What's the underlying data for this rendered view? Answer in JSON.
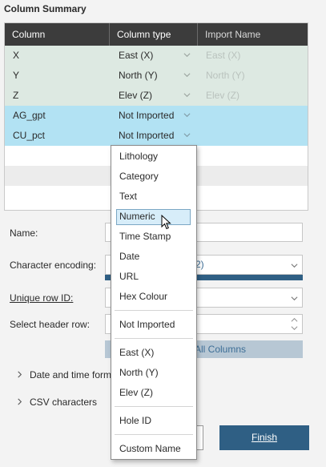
{
  "section_title": "Column Summary",
  "table": {
    "headers": [
      "Column",
      "Column type",
      "Import Name"
    ],
    "rows": [
      {
        "column": "X",
        "type": "East (X)",
        "import_name": "East (X)"
      },
      {
        "column": "Y",
        "type": "North (Y)",
        "import_name": "North (Y)"
      },
      {
        "column": "Z",
        "type": "Elev (Z)",
        "import_name": "Elev (Z)"
      },
      {
        "column": "AG_gpt",
        "type": "Not Imported",
        "import_name": ""
      },
      {
        "column": "CU_pct",
        "type": "Not Imported",
        "import_name": ""
      }
    ]
  },
  "form": {
    "name_label": "Name:",
    "encoding_label": "Character encoding:",
    "encoding_value_suffix": "2)",
    "unique_row_label": "Unique row ID:",
    "header_row_label": "Select header row:",
    "all_columns_label": "All Columns",
    "date_time_label": "Date and time form",
    "csv_chars_label": "CSV characters"
  },
  "dropdown": {
    "group1": [
      "Lithology",
      "Category",
      "Text",
      "Numeric",
      "Time Stamp",
      "Date",
      "URL",
      "Hex Colour"
    ],
    "group2": [
      "Not Imported"
    ],
    "group3": [
      "East (X)",
      "North (Y)",
      "Elev (Z)"
    ],
    "group4": [
      "Hole ID"
    ],
    "group5": [
      "Custom Name"
    ],
    "highlighted": "Numeric"
  },
  "buttons": {
    "finish": "Finish"
  },
  "icons": {
    "chevron": "chevron-down-icon",
    "expand": "chevron-right-icon",
    "cursor": "mouse-pointer-icon"
  },
  "colors": {
    "header_bg": "#3c3c3c",
    "row_green": "#dde9e2",
    "row_blue": "#b2e2f3",
    "accent": "#2f5f84"
  }
}
